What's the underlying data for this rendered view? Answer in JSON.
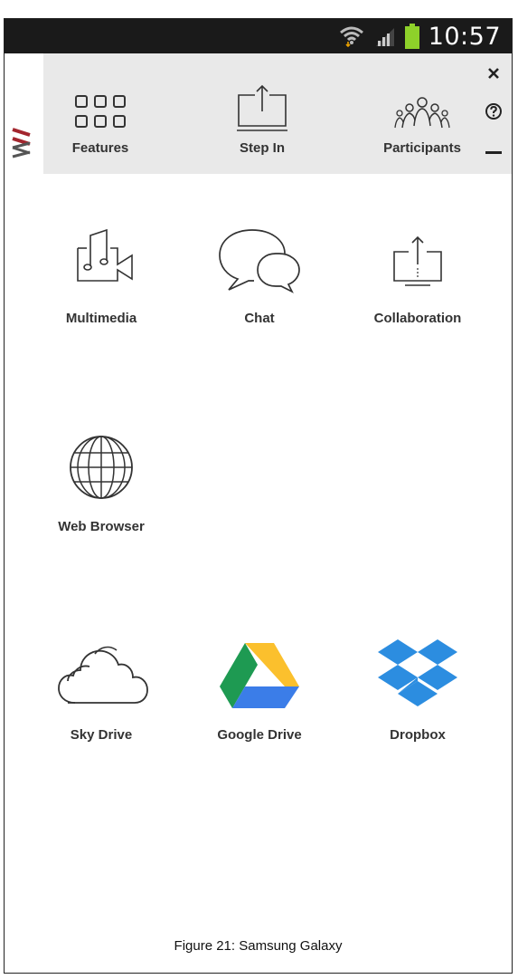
{
  "status_bar": {
    "time": "10:57"
  },
  "toolbar": {
    "features_label": "Features",
    "step_in_label": "Step In",
    "participants_label": "Participants"
  },
  "apps": {
    "multimedia": "Multimedia",
    "chat": "Chat",
    "collaboration": "Collaboration",
    "web_browser": "Web Browser",
    "sky_drive": "Sky Drive",
    "google_drive": "Google Drive",
    "dropbox": "Dropbox"
  },
  "caption": "Figure 21: Samsung Galaxy",
  "colors": {
    "status_bar_bg": "#1a1a1a",
    "toolbar_bg": "#e9e9e9",
    "logo_red": "#a3262e",
    "battery_green": "#8ed12a",
    "dropbox_blue": "#2c8de0"
  }
}
